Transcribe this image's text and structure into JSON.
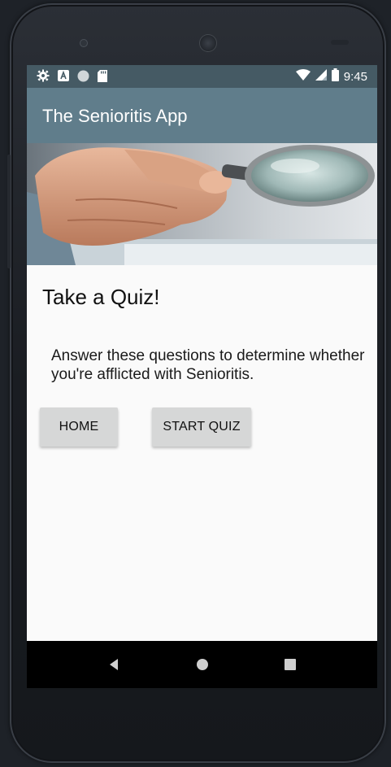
{
  "status_bar": {
    "time": "9:45",
    "left_icons": [
      "settings-icon",
      "a-notification-icon",
      "circle-notification-icon",
      "sd-card-icon"
    ],
    "right_icons": [
      "wifi-icon",
      "signal-icon",
      "battery-icon"
    ]
  },
  "app_bar": {
    "title": "The Senioritis App"
  },
  "hero": {
    "image": "hand-holding-magnifying-glass"
  },
  "main": {
    "heading": "Take a Quiz!",
    "description": "Answer these questions to determine whether you're afflicted with Senioritis.",
    "buttons": {
      "home": "HOME",
      "start_quiz": "START QUIZ"
    }
  },
  "nav_bar": {
    "icons": [
      "back-icon",
      "home-icon",
      "recents-icon"
    ]
  },
  "colors": {
    "status_bar": "#455a64",
    "app_bar": "#607d8b",
    "background": "#fafafa",
    "button": "#d6d7d7"
  }
}
